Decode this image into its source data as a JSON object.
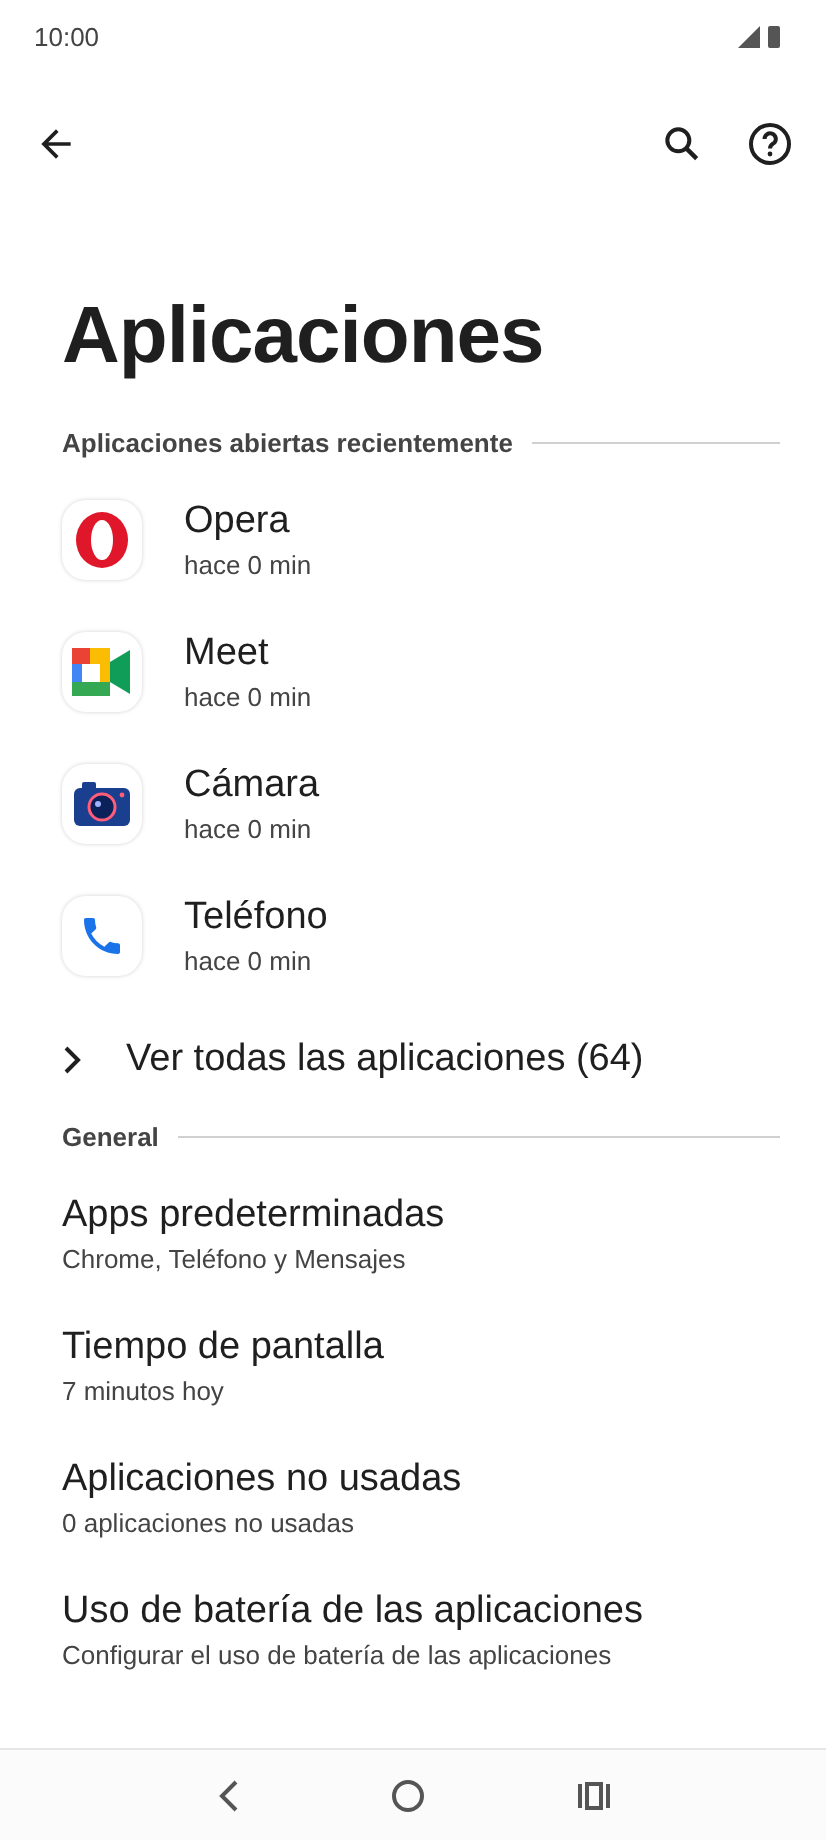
{
  "status_bar": {
    "time": "10:00"
  },
  "title": "Aplicaciones",
  "recent": {
    "header": "Aplicaciones abiertas recientemente",
    "apps": [
      {
        "kind": "opera",
        "name": "Opera",
        "time": "hace 0 min"
      },
      {
        "kind": "meet",
        "name": "Meet",
        "time": "hace 0 min"
      },
      {
        "kind": "camera",
        "name": "Cámara",
        "time": "hace 0 min"
      },
      {
        "kind": "phone",
        "name": "Teléfono",
        "time": "hace 0 min"
      }
    ],
    "see_all": "Ver todas las aplicaciones (64)"
  },
  "general": {
    "header": "General",
    "items": [
      {
        "title": "Apps predeterminadas",
        "subtitle": "Chrome, Teléfono y Mensajes"
      },
      {
        "title": "Tiempo de pantalla",
        "subtitle": "7 minutos hoy"
      },
      {
        "title": "Aplicaciones no usadas",
        "subtitle": "0 aplicaciones no usadas"
      },
      {
        "title": "Uso de batería de las aplicaciones",
        "subtitle": "Configurar el uso de batería de las aplicaciones"
      }
    ]
  }
}
